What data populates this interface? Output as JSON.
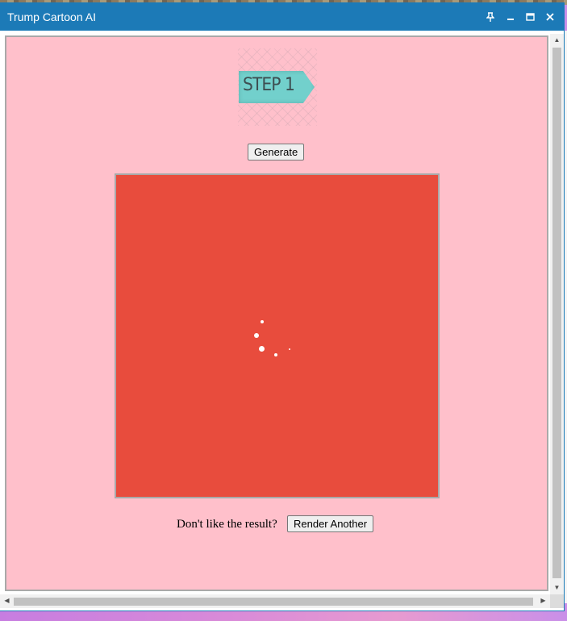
{
  "window": {
    "title": "Trump Cartoon AI",
    "controls": [
      "pin-icon",
      "minimize-icon",
      "maximize-icon",
      "close-icon"
    ]
  },
  "step_badge": {
    "text": "STEP 1"
  },
  "generate_button": {
    "label": "Generate"
  },
  "result_canvas": {
    "background": "#e84c3d",
    "state": "loading-spinner"
  },
  "footer": {
    "prompt": "Don't like the result?",
    "render_button": "Render Another"
  },
  "colors": {
    "titlebar": "#1c7ab7",
    "page_background": "#ffc0cb",
    "badge": "#72d0cc",
    "canvas": "#e84c3d"
  }
}
